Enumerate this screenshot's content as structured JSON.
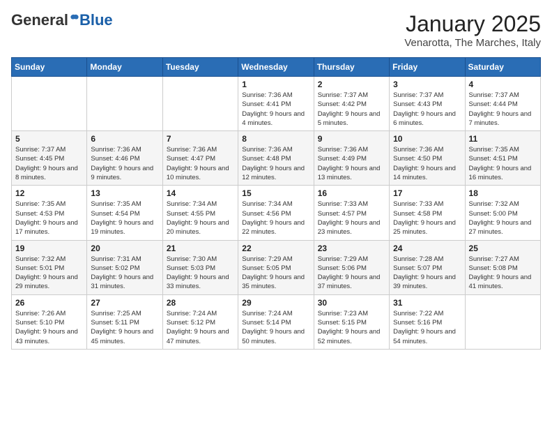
{
  "header": {
    "logo_general": "General",
    "logo_blue": "Blue",
    "month": "January 2025",
    "location": "Venarotta, The Marches, Italy"
  },
  "weekdays": [
    "Sunday",
    "Monday",
    "Tuesday",
    "Wednesday",
    "Thursday",
    "Friday",
    "Saturday"
  ],
  "weeks": [
    [
      {
        "day": "",
        "info": ""
      },
      {
        "day": "",
        "info": ""
      },
      {
        "day": "",
        "info": ""
      },
      {
        "day": "1",
        "info": "Sunrise: 7:36 AM\nSunset: 4:41 PM\nDaylight: 9 hours and 4 minutes."
      },
      {
        "day": "2",
        "info": "Sunrise: 7:37 AM\nSunset: 4:42 PM\nDaylight: 9 hours and 5 minutes."
      },
      {
        "day": "3",
        "info": "Sunrise: 7:37 AM\nSunset: 4:43 PM\nDaylight: 9 hours and 6 minutes."
      },
      {
        "day": "4",
        "info": "Sunrise: 7:37 AM\nSunset: 4:44 PM\nDaylight: 9 hours and 7 minutes."
      }
    ],
    [
      {
        "day": "5",
        "info": "Sunrise: 7:37 AM\nSunset: 4:45 PM\nDaylight: 9 hours and 8 minutes."
      },
      {
        "day": "6",
        "info": "Sunrise: 7:36 AM\nSunset: 4:46 PM\nDaylight: 9 hours and 9 minutes."
      },
      {
        "day": "7",
        "info": "Sunrise: 7:36 AM\nSunset: 4:47 PM\nDaylight: 9 hours and 10 minutes."
      },
      {
        "day": "8",
        "info": "Sunrise: 7:36 AM\nSunset: 4:48 PM\nDaylight: 9 hours and 12 minutes."
      },
      {
        "day": "9",
        "info": "Sunrise: 7:36 AM\nSunset: 4:49 PM\nDaylight: 9 hours and 13 minutes."
      },
      {
        "day": "10",
        "info": "Sunrise: 7:36 AM\nSunset: 4:50 PM\nDaylight: 9 hours and 14 minutes."
      },
      {
        "day": "11",
        "info": "Sunrise: 7:35 AM\nSunset: 4:51 PM\nDaylight: 9 hours and 16 minutes."
      }
    ],
    [
      {
        "day": "12",
        "info": "Sunrise: 7:35 AM\nSunset: 4:53 PM\nDaylight: 9 hours and 17 minutes."
      },
      {
        "day": "13",
        "info": "Sunrise: 7:35 AM\nSunset: 4:54 PM\nDaylight: 9 hours and 19 minutes."
      },
      {
        "day": "14",
        "info": "Sunrise: 7:34 AM\nSunset: 4:55 PM\nDaylight: 9 hours and 20 minutes."
      },
      {
        "day": "15",
        "info": "Sunrise: 7:34 AM\nSunset: 4:56 PM\nDaylight: 9 hours and 22 minutes."
      },
      {
        "day": "16",
        "info": "Sunrise: 7:33 AM\nSunset: 4:57 PM\nDaylight: 9 hours and 23 minutes."
      },
      {
        "day": "17",
        "info": "Sunrise: 7:33 AM\nSunset: 4:58 PM\nDaylight: 9 hours and 25 minutes."
      },
      {
        "day": "18",
        "info": "Sunrise: 7:32 AM\nSunset: 5:00 PM\nDaylight: 9 hours and 27 minutes."
      }
    ],
    [
      {
        "day": "19",
        "info": "Sunrise: 7:32 AM\nSunset: 5:01 PM\nDaylight: 9 hours and 29 minutes."
      },
      {
        "day": "20",
        "info": "Sunrise: 7:31 AM\nSunset: 5:02 PM\nDaylight: 9 hours and 31 minutes."
      },
      {
        "day": "21",
        "info": "Sunrise: 7:30 AM\nSunset: 5:03 PM\nDaylight: 9 hours and 33 minutes."
      },
      {
        "day": "22",
        "info": "Sunrise: 7:29 AM\nSunset: 5:05 PM\nDaylight: 9 hours and 35 minutes."
      },
      {
        "day": "23",
        "info": "Sunrise: 7:29 AM\nSunset: 5:06 PM\nDaylight: 9 hours and 37 minutes."
      },
      {
        "day": "24",
        "info": "Sunrise: 7:28 AM\nSunset: 5:07 PM\nDaylight: 9 hours and 39 minutes."
      },
      {
        "day": "25",
        "info": "Sunrise: 7:27 AM\nSunset: 5:08 PM\nDaylight: 9 hours and 41 minutes."
      }
    ],
    [
      {
        "day": "26",
        "info": "Sunrise: 7:26 AM\nSunset: 5:10 PM\nDaylight: 9 hours and 43 minutes."
      },
      {
        "day": "27",
        "info": "Sunrise: 7:25 AM\nSunset: 5:11 PM\nDaylight: 9 hours and 45 minutes."
      },
      {
        "day": "28",
        "info": "Sunrise: 7:24 AM\nSunset: 5:12 PM\nDaylight: 9 hours and 47 minutes."
      },
      {
        "day": "29",
        "info": "Sunrise: 7:24 AM\nSunset: 5:14 PM\nDaylight: 9 hours and 50 minutes."
      },
      {
        "day": "30",
        "info": "Sunrise: 7:23 AM\nSunset: 5:15 PM\nDaylight: 9 hours and 52 minutes."
      },
      {
        "day": "31",
        "info": "Sunrise: 7:22 AM\nSunset: 5:16 PM\nDaylight: 9 hours and 54 minutes."
      },
      {
        "day": "",
        "info": ""
      }
    ]
  ]
}
